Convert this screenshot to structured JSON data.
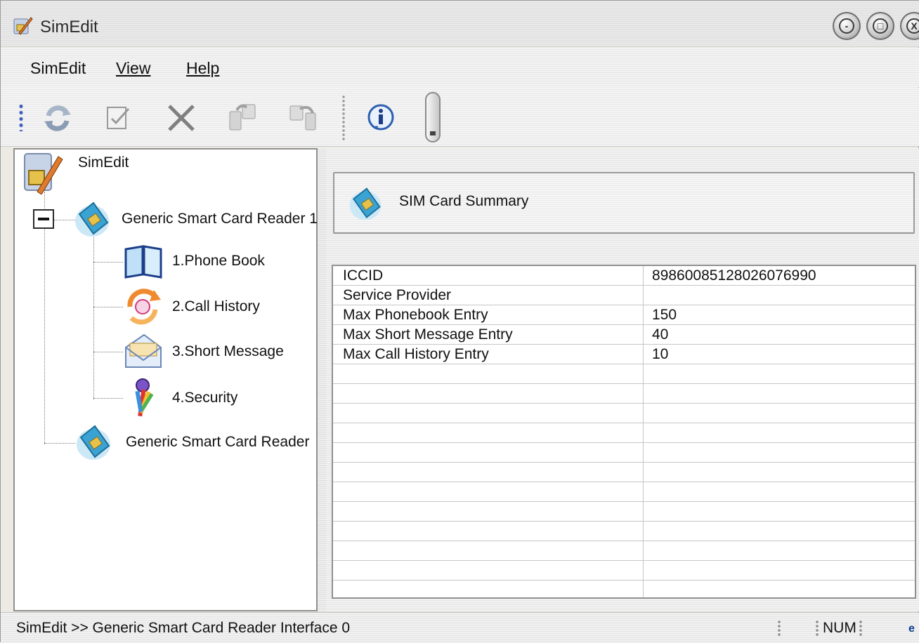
{
  "window": {
    "title": "SimEdit",
    "controls": {
      "minimize": "-",
      "maximize": "□",
      "close": "X"
    }
  },
  "menu": [
    {
      "label": "SimEdit"
    },
    {
      "label": "View"
    },
    {
      "label": "Help"
    }
  ],
  "toolbar": {
    "buttons": [
      {
        "icon": "refresh-icon"
      },
      {
        "icon": "edit-icon"
      },
      {
        "icon": "delete-icon"
      },
      {
        "icon": "copy-to-sim-icon"
      },
      {
        "icon": "copy-from-sim-icon"
      },
      {
        "icon": "info-icon"
      }
    ]
  },
  "tree": {
    "root": {
      "label": "SimEdit"
    },
    "readers": [
      {
        "label": "Generic Smart Card Reader 1",
        "expanded": true,
        "children": [
          {
            "label": "1.Phone Book"
          },
          {
            "label": "2.Call History"
          },
          {
            "label": "3.Short Message"
          },
          {
            "label": "4.Security"
          }
        ]
      },
      {
        "label": "Generic Smart Card Reader"
      }
    ]
  },
  "summary": {
    "title": "SIM Card Summary",
    "rows": [
      {
        "name": "ICCID",
        "value": "89860085128026076990"
      },
      {
        "name": "Service Provider",
        "value": ""
      },
      {
        "name": "Max Phonebook Entry",
        "value": "150"
      },
      {
        "name": "Max Short Message Entry",
        "value": "40"
      },
      {
        "name": "Max Call History Entry",
        "value": "10"
      }
    ]
  },
  "status": {
    "path": "SimEdit  >>  Generic Smart Card Reader Interface 0",
    "num": "NUM",
    "indicator": "e"
  }
}
